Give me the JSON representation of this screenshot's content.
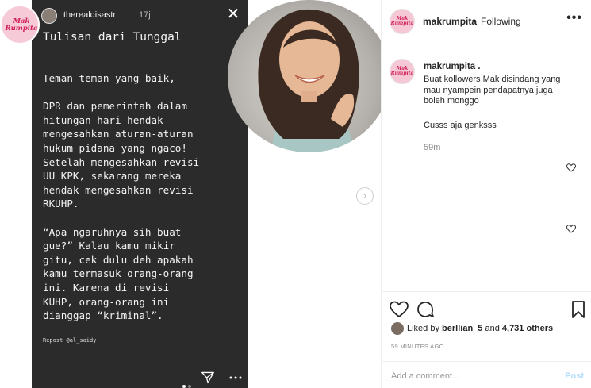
{
  "story": {
    "username": "therealdisastr",
    "time": "17j",
    "title": "Tulisan dari Tunggal",
    "body": "Teman-teman yang baik,\n\nDPR dan pemerintah dalam\nhitungan hari hendak\nmengesahkan aturan-aturan\nhukum pidana yang ngaco!\nSetelah mengesahkan revisi\nUU KPK, sekarang mereka\nhendak mengesahkan revisi\nRKUHP.\n\n“Apa ngaruhnya sih buat\ngue?” Kalau kamu mikir\ngitu, cek dulu deh apakah\nkamu termasuk orang-orang\nini. Karena di revisi\nKUHP, orang-orang ini\ndianggap “kriminal”.",
    "repost": "Repost @al_saidy"
  },
  "sticker": {
    "text": "Mak Rumpita"
  },
  "post": {
    "username": "makrumpita",
    "separator": "•",
    "follow_status": "Following",
    "more": "•••",
    "avatar_text": "Mak Rumpita"
  },
  "caption": {
    "username": "makrumpita .",
    "text": "Buat kollowers Mak disindang yang mau nyampein pendapatnya juga boleh monggo",
    "text2": "Cusss aja genksss",
    "time": "59m"
  },
  "likes": {
    "prefix": "Liked by",
    "user": "berllian_5",
    "joiner": "and",
    "count": "4,731 others"
  },
  "timestamp": "59 MINUTES AGO",
  "comment": {
    "placeholder": "Add a comment...",
    "post_label": "Post"
  },
  "colors": {
    "story_bg": "#2b2b2b",
    "brand_pink": "#d0205a",
    "post_disabled": "#b2dffc"
  }
}
